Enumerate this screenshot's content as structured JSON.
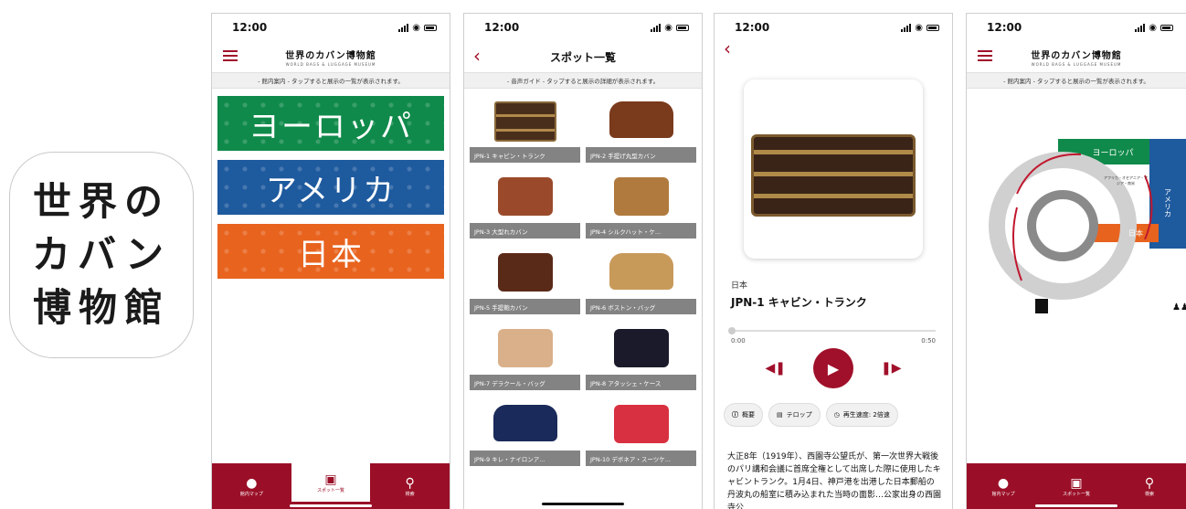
{
  "app_icon": {
    "lines": [
      "世界の",
      "カバン",
      "博物館"
    ]
  },
  "status": {
    "time": "12:00"
  },
  "logo": {
    "main": "世界のカバン博物館",
    "sub": "WORLD BAGS & LUGGAGE MUSEUM"
  },
  "screen_map": {
    "subtitle": "- 館内案内 - タップすると展示の一覧が表示されます。",
    "areas": [
      {
        "label": "ヨーロッパ",
        "color": "#0f8a4a"
      },
      {
        "label": "アメリカ",
        "color": "#1e5a9e"
      },
      {
        "label": "日本",
        "color": "#e8631e"
      }
    ]
  },
  "tabs": [
    {
      "label": "館内マップ",
      "icon": "map-pin-icon"
    },
    {
      "label": "スポット一覧",
      "icon": "suitcase-icon"
    },
    {
      "label": "検索",
      "icon": "search-icon"
    }
  ],
  "screen_spots": {
    "title": "スポット一覧",
    "subtitle": "- 音声ガイド - タップすると展示の詳細が表示されます。",
    "items": [
      {
        "caption": "JPN-1 キャビン・トランク"
      },
      {
        "caption": "JPN-2 手提げ丸型カバン"
      },
      {
        "caption": "JPN-3 大型れカバン"
      },
      {
        "caption": "JPN-4 シルクハット・ケ..."
      },
      {
        "caption": "JPN-5 手提鞄カバン"
      },
      {
        "caption": "JPN-6 ボストン・バッグ"
      },
      {
        "caption": "JPN-7 デラクール・バッグ"
      },
      {
        "caption": "JPN-8 アタッシェ・ケース"
      },
      {
        "caption": "JPN-9 キレ・ナイロンア..."
      },
      {
        "caption": "JPN-10 デボネア・スーツケ..."
      }
    ]
  },
  "screen_detail": {
    "area": "日本",
    "title": "JPN-1 キャビン・トランク",
    "time_current": "0:00",
    "time_total": "0:50",
    "pills": [
      {
        "label": "概要",
        "icon": "info-icon"
      },
      {
        "label": "テロップ",
        "icon": "caption-icon"
      },
      {
        "label": "再生速度: 2倍速",
        "icon": "clock-icon"
      }
    ],
    "description": "大正8年（1919年）、西園寺公望氏が、第一次世界大戦後のパリ講和会議に首席全権として出席した際に使用したキャビントランク。1月4日、神戸港を出港した日本郵船の丹波丸の船室に積み込まれた当時の面影…公家出身の西園寺公"
  },
  "screen_floor": {
    "subtitle": "- 館内案内 - タップすると展示の一覧が表示されます。",
    "labels": {
      "europe": "ヨーロッパ",
      "america": "アメリカ",
      "japan": "日本",
      "middle": "アフリカ・オセアニア・アジア・南米"
    }
  }
}
